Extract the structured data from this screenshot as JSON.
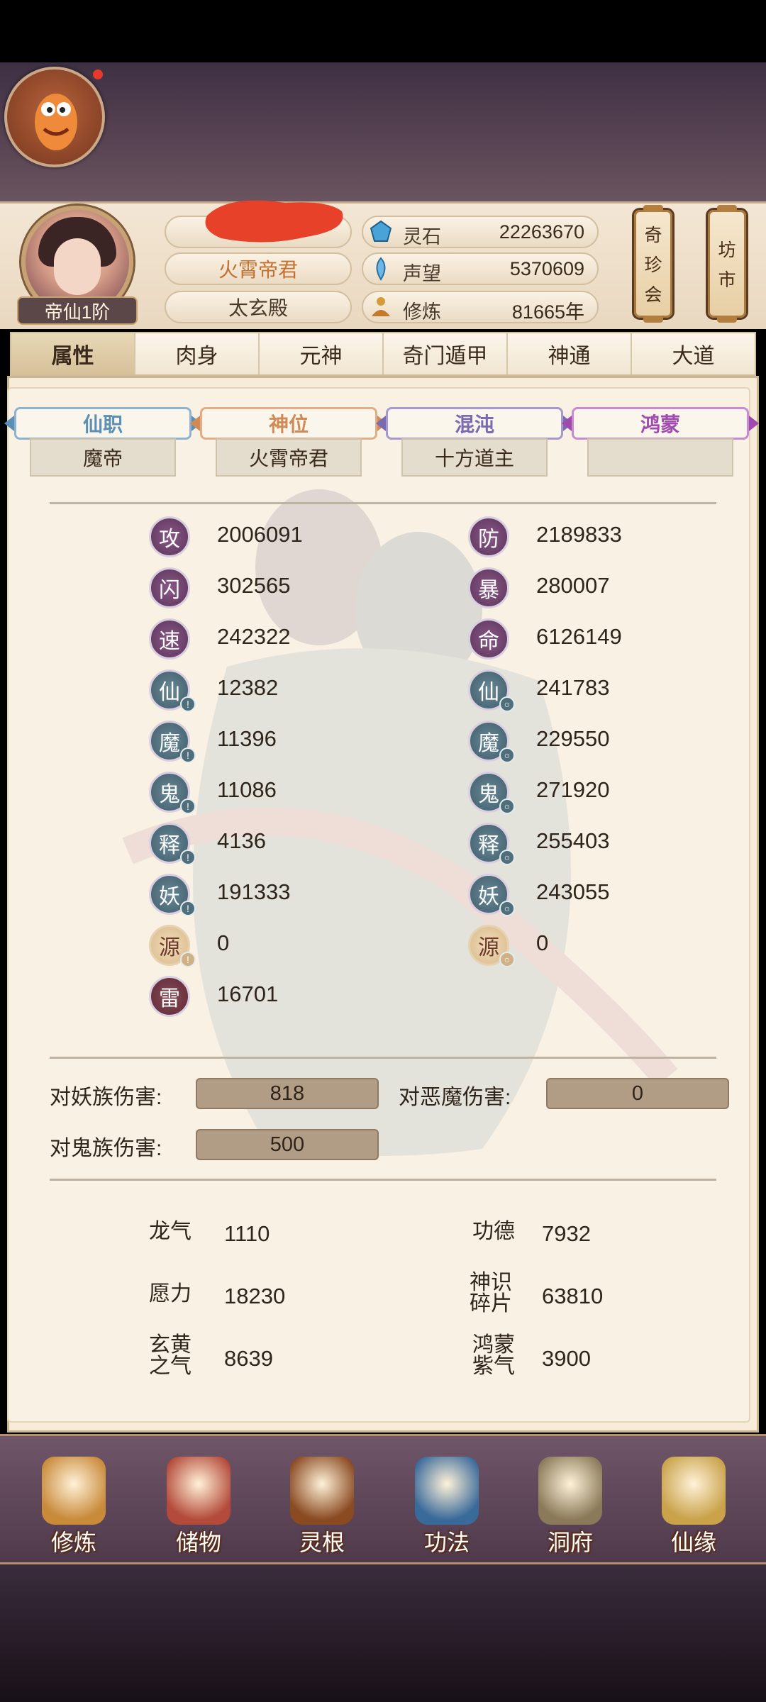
{
  "header": {
    "rank_label": "帝仙1阶",
    "player_title": "火霄帝君",
    "sect_name": "太玄殿",
    "resources": [
      {
        "icon": "spirit-stone-icon",
        "label": "灵石",
        "value": "22263670"
      },
      {
        "icon": "prestige-icon",
        "label": "声望",
        "value": "5370609"
      },
      {
        "icon": "cultivation-icon",
        "label": "修炼",
        "value": "81665年"
      }
    ],
    "side_buttons": [
      {
        "chars": [
          "奇",
          "珍",
          "会"
        ]
      },
      {
        "chars": [
          "坊",
          "市"
        ]
      }
    ]
  },
  "tabs": [
    {
      "label": "属性",
      "active": true
    },
    {
      "label": "肉身"
    },
    {
      "label": "元神"
    },
    {
      "label": "奇门遁甲"
    },
    {
      "label": "神通"
    },
    {
      "label": "大道"
    }
  ],
  "ranks": [
    {
      "label": "仙职",
      "value": "魔帝",
      "color": "#5b8fb5"
    },
    {
      "label": "神位",
      "value": "火霄帝君",
      "color": "#d08a55"
    },
    {
      "label": "混沌",
      "value": "十方道主",
      "color": "#7a6ab0"
    },
    {
      "label": "鸿蒙",
      "value": "",
      "color": "#a04ab0"
    }
  ],
  "stats_left": [
    {
      "glyph": "攻",
      "value": "2006091",
      "style": "purple"
    },
    {
      "glyph": "闪",
      "value": "302565",
      "style": "purple"
    },
    {
      "glyph": "速",
      "value": "242322",
      "style": "purple"
    },
    {
      "glyph": "仙",
      "value": "12382",
      "style": "teal",
      "badge": "!"
    },
    {
      "glyph": "魔",
      "value": "11396",
      "style": "teal",
      "badge": "!"
    },
    {
      "glyph": "鬼",
      "value": "11086",
      "style": "teal",
      "badge": "!"
    },
    {
      "glyph": "释",
      "value": "4136",
      "style": "teal",
      "badge": "!"
    },
    {
      "glyph": "妖",
      "value": "191333",
      "style": "teal",
      "badge": "!"
    },
    {
      "glyph": "源",
      "value": "0",
      "style": "gold",
      "badge": "!"
    },
    {
      "glyph": "雷",
      "value": "16701",
      "style": "red"
    }
  ],
  "stats_right": [
    {
      "glyph": "防",
      "value": "2189833",
      "style": "purple"
    },
    {
      "glyph": "暴",
      "value": "280007",
      "style": "purple"
    },
    {
      "glyph": "命",
      "value": "6126149",
      "style": "purple"
    },
    {
      "glyph": "仙",
      "value": "241783",
      "style": "teal",
      "badge": "o"
    },
    {
      "glyph": "魔",
      "value": "229550",
      "style": "teal",
      "badge": "o"
    },
    {
      "glyph": "鬼",
      "value": "271920",
      "style": "teal",
      "badge": "o"
    },
    {
      "glyph": "释",
      "value": "255403",
      "style": "teal",
      "badge": "o"
    },
    {
      "glyph": "妖",
      "value": "243055",
      "style": "teal",
      "badge": "o"
    },
    {
      "glyph": "源",
      "value": "0",
      "style": "gold",
      "badge": "o"
    }
  ],
  "damage": {
    "vs_yao_label": "对妖族伤害:",
    "vs_yao_value": "818",
    "vs_demon_label": "对恶魔伤害:",
    "vs_demon_value": "0",
    "vs_ghost_label": "对鬼族伤害:",
    "vs_ghost_value": "500"
  },
  "misc": [
    {
      "label": "龙气",
      "value": "1110"
    },
    {
      "label": "功德",
      "value": "7932"
    },
    {
      "label": "愿力",
      "value": "18230"
    },
    {
      "label": "神识碎片",
      "value": "63810"
    },
    {
      "label": "玄黄之气",
      "value": "8639"
    },
    {
      "label": "鸿蒙紫气",
      "value": "3900"
    }
  ],
  "nav": [
    {
      "label": "修炼",
      "icon": "meditating-figure-icon",
      "color": "#c98a3a"
    },
    {
      "label": "储物",
      "icon": "storage-bag-icon",
      "color": "#b44a3a"
    },
    {
      "label": "灵根",
      "icon": "spirit-root-icon",
      "color": "#8a4a22"
    },
    {
      "label": "功法",
      "icon": "technique-book-icon",
      "color": "#3a6a9a"
    },
    {
      "label": "洞府",
      "icon": "cave-dwelling-icon",
      "color": "#8a7a5a"
    },
    {
      "label": "仙缘",
      "icon": "fate-gourd-icon",
      "color": "#c9a24a"
    }
  ]
}
